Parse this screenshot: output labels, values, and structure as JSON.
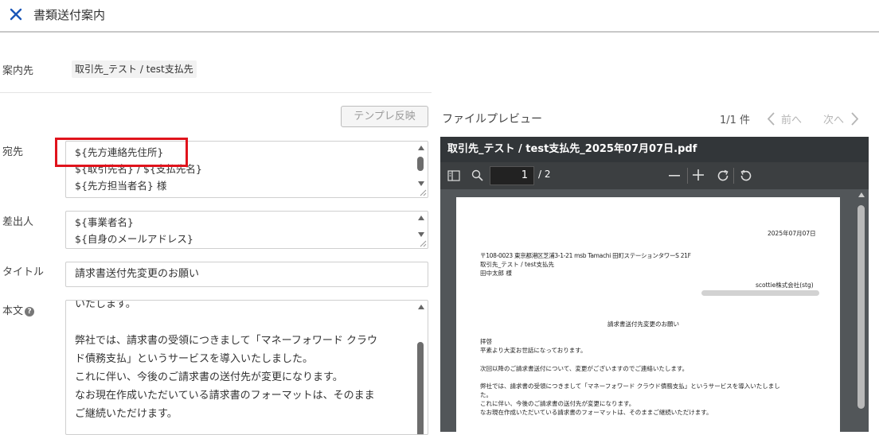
{
  "header": {
    "title": "書類送付案内"
  },
  "recipient": {
    "label": "案内先",
    "value": "取引先_テスト / test支払先"
  },
  "template_button": "テンプレ反映",
  "fields": {
    "to": {
      "label": "宛先",
      "lines": [
        "${先方連絡先住所}",
        "${取引先名} / ${支払先名}",
        "${先方担当者名} 様"
      ]
    },
    "sender": {
      "label": "差出人",
      "lines": [
        "${事業者名}",
        "${自身のメールアドレス}"
      ]
    },
    "title": {
      "label": "タイトル",
      "value": "請求書送付先変更のお願い"
    },
    "body": {
      "label": "本文",
      "lines": [
        "いたします。",
        "",
        "弊社では、請求書の受領につきまして「マネーフォワード クラウ",
        "ド債務支払」というサービスを導入いたしました。",
        "これに伴い、今後のご請求書の送付先が変更になります。",
        "なお現在作成いただいている請求書のフォーマットは、そのまま",
        "ご継続いただけます。"
      ]
    }
  },
  "preview": {
    "title": "ファイルプレビュー",
    "count": "1/1 件",
    "prev": "前へ",
    "next": "次へ",
    "pdf": {
      "filename": "取引先_テスト / test支払先_2025年07月07日.pdf",
      "page": "1",
      "total": "/ 2",
      "doc": {
        "date": "2025年07月07日",
        "address": "〒108-0023 東京都港区芝浦3-1-21 msb Tamachi 田町ステーションタワーS 21F",
        "to_company": "取引先_テスト / test支払先",
        "to_person": "田中太郎 様",
        "from_company": "scottie株式会社(stg)",
        "subject": "請求書送付先変更のお願い",
        "greeting": "拝啓",
        "p1": "平素より大変お世話になっております。",
        "p2": "次回以降のご請求書送付について、変更がございますのでご連絡いたします。",
        "p3a": "弊社では、請求書の受領につきまして「マネーフォワード クラウド債務支払」というサービスを導入いたしまし",
        "p3b": "た。",
        "p4": "これに伴い、今後のご請求書の送付先が変更になります。",
        "p5": "なお現在作成いただいている請求書のフォーマットは、そのままご継続いただけます。"
      }
    }
  },
  "colors": {
    "accent": "#1a56b8",
    "highlight": "#e0131c"
  }
}
